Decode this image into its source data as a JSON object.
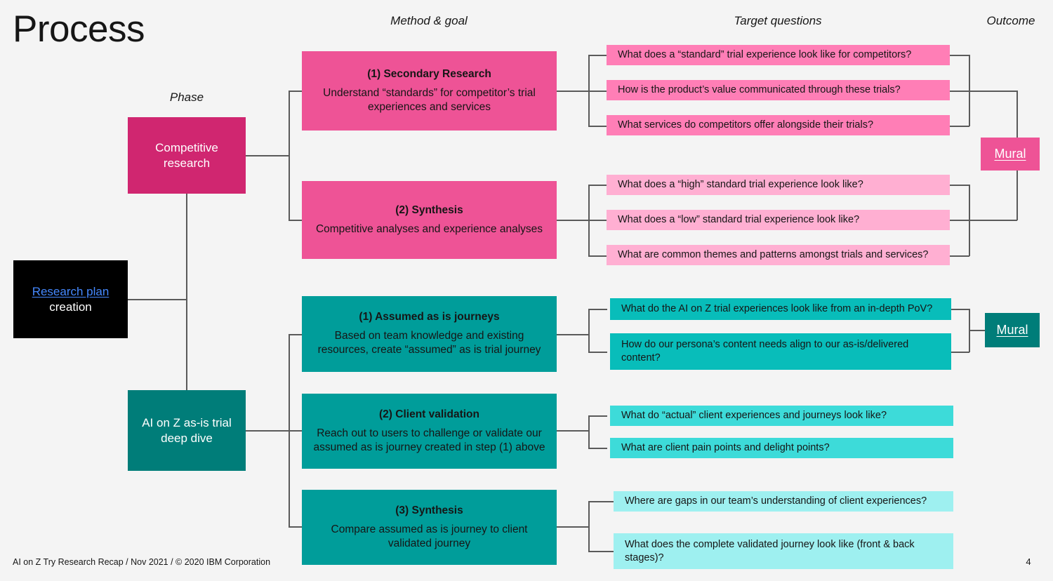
{
  "page_title": "Process",
  "columns": {
    "phase": "Phase",
    "method_goal": "Method & goal",
    "target_questions": "Target questions",
    "outcome": "Outcome"
  },
  "colors": {
    "background": "#f4f4f4",
    "black": "#000000",
    "magenta": "#d02670",
    "pink": "#ee5396",
    "pink_light": "#ff7eb6",
    "pink_lighter": "#ffafd2",
    "teal_dark": "#007d79",
    "teal": "#009d9a",
    "teal_light": "#08bdba",
    "teal_lighter": "#3ddbd9",
    "teal_lightest": "#9ef0f0",
    "link_blue": "#4589ff",
    "connector": "#5a5a5a"
  },
  "start_node": {
    "link_label": "Research plan",
    "second_line": "creation"
  },
  "phases": [
    {
      "label_line1": "Competitive",
      "label_line2": "research"
    },
    {
      "label_line1": "AI on Z as-is trial",
      "label_line2": "deep dive"
    }
  ],
  "methods": [
    {
      "title": "(1) Secondary Research",
      "desc_line1": "Understand “standards” for competitor’s trial",
      "desc_line2": "experiences and services"
    },
    {
      "title": "(2) Synthesis",
      "desc_line1": "Competitive analyses and experience analyses",
      "desc_line2": ""
    },
    {
      "title": "(1) Assumed as is journeys",
      "desc_line1": "Based on team knowledge and existing",
      "desc_line2": "resources, create “assumed” as is trial journey"
    },
    {
      "title": "(2) Client validation",
      "desc_line1": "Reach out to users to challenge or validate our",
      "desc_line2": "assumed as is journey created in step (1) above"
    },
    {
      "title": "(3) Synthesis",
      "desc_line1": "Compare assumed as is journey to client",
      "desc_line2": "validated journey"
    }
  ],
  "questions": {
    "group1": [
      "What does a “standard” trial experience look like for competitors?",
      "How is the product’s value communicated through these trials?",
      "What services do competitors offer alongside their trials?"
    ],
    "group2": [
      "What does a “high” standard trial experience look like?",
      "What does a “low” standard trial experience look like?",
      "What are common themes and patterns amongst trials and services?"
    ],
    "group3": [
      "What do the AI on Z trial experiences look like from an in-depth PoV?",
      "How do our persona’s content needs align to our as-is/delivered content?"
    ],
    "group4": [
      "What do “actual” client experiences and journeys look like?",
      "What are client pain points and delight points?"
    ],
    "group5": [
      "Where are gaps in our team’s understanding of client experiences?",
      "What does the complete validated journey look like (front & back stages)?"
    ]
  },
  "outcomes": [
    {
      "label": "Mural"
    },
    {
      "label": "Mural"
    }
  ],
  "footer": {
    "text": "AI on Z Try Research Recap / Nov 2021 / © 2020 IBM Corporation",
    "page_number": "4"
  }
}
